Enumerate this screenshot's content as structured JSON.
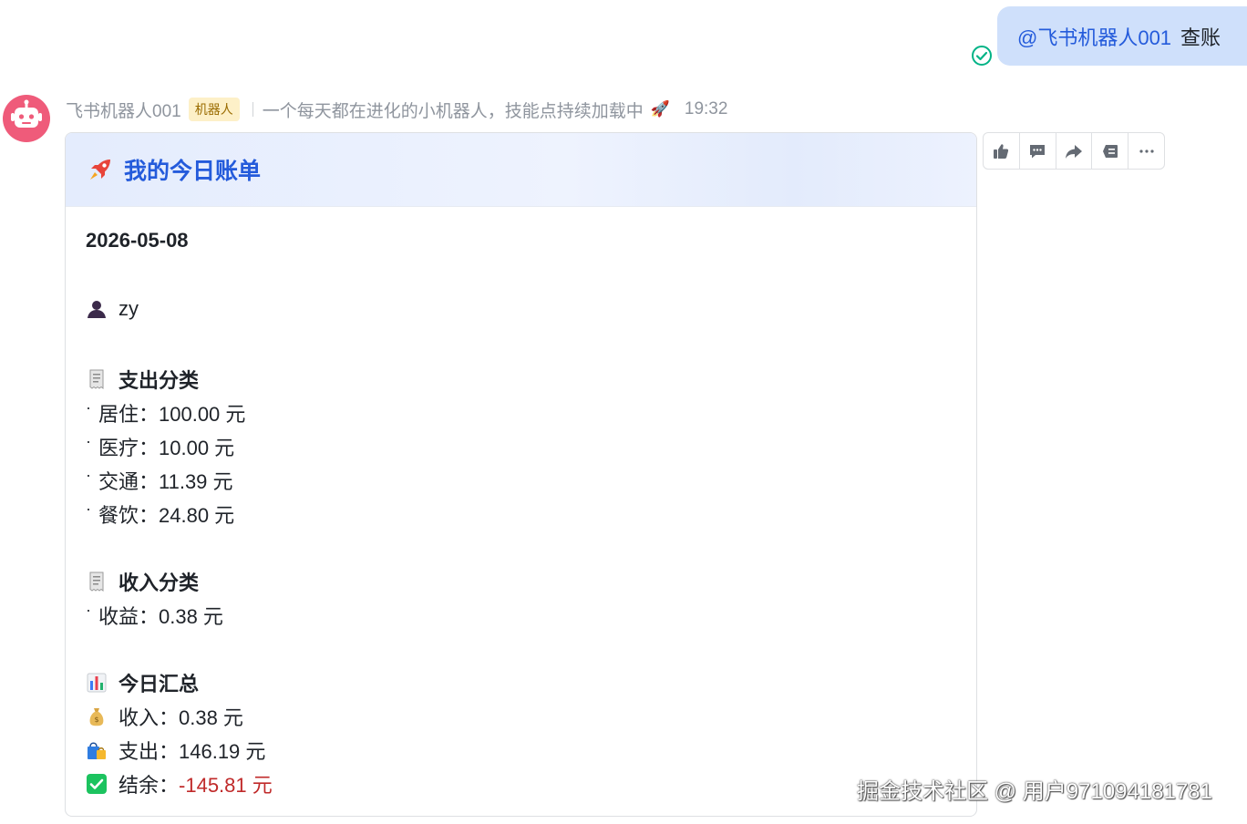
{
  "outgoing": {
    "mention": "@飞书机器人001",
    "text": "查账"
  },
  "bot": {
    "name": "飞书机器人001",
    "badge": "机器人",
    "signature": "一个每天都在进化的小机器人，技能点持续加载中",
    "time": "19:32"
  },
  "card": {
    "title": "我的今日账单",
    "date": "2026-05-08",
    "user": "zy",
    "expense_title": "支出分类",
    "expense_items": [
      "居住：100.00 元",
      "医疗：10.00 元",
      "交通：11.39 元",
      "餐饮：24.80 元"
    ],
    "income_title": "收入分类",
    "income_items": [
      "收益：0.38 元"
    ],
    "summary_title": "今日汇总",
    "summary": {
      "income": "收入：0.38 元",
      "expense": "支出：146.19 元",
      "balance_label": "结余：",
      "balance_value": "-145.81 元"
    }
  },
  "toolbar_icons": [
    "thumbs-up-icon",
    "comment-icon",
    "forward-icon",
    "quote-icon",
    "more-icon"
  ],
  "colors": {
    "accent": "#245bdb",
    "negative": "#c02a2a",
    "bubble": "#cfe0fb",
    "check": "#00b386"
  },
  "watermark": "掘金技术社区 @ 用户971094181781"
}
